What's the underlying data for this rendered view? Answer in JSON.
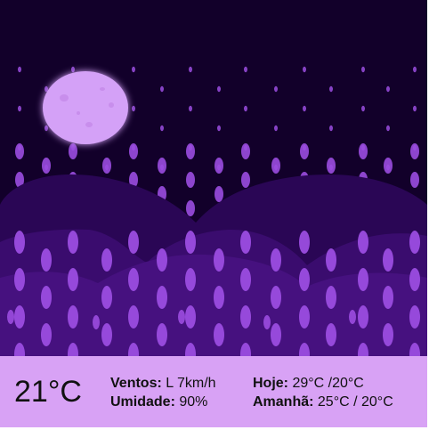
{
  "weather": {
    "current_temp": "21°C",
    "wind_label": "Ventos:",
    "wind_value": "L 7km/h",
    "humidity_label": "Umidade:",
    "humidity_value": "90%",
    "today_label": "Hoje:",
    "today_value": "29°C /20°C",
    "tomorrow_label": "Amanhã:",
    "tomorrow_value": "25°C / 20°C"
  },
  "scene": {
    "condition": "rain-night",
    "icons": [
      "moon-icon",
      "raindrop-icon",
      "hill-shape"
    ],
    "colors": {
      "sky": "#12002a",
      "hill_back": "#2a0655",
      "hill_mid": "#3a0c6e",
      "hill_front": "#46117f",
      "rain": "#9b4de0",
      "moon": "#d4a1f7",
      "info_bar": "#d8a2f5"
    }
  }
}
